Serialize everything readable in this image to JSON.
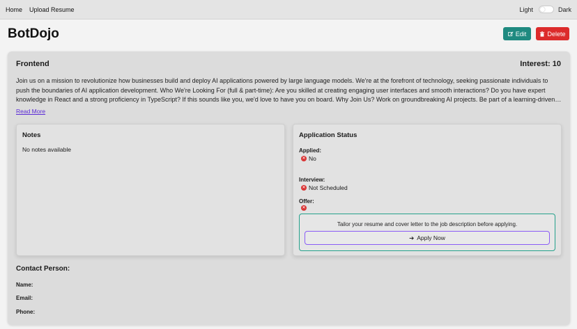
{
  "nav": {
    "home": "Home",
    "upload": "Upload Resume",
    "theme_light": "Light",
    "theme_dark": "Dark"
  },
  "header": {
    "title": "BotDojo",
    "edit_label": "Edit",
    "delete_label": "Delete"
  },
  "job": {
    "title": "Frontend",
    "interest": "Interest: 10",
    "description": "Join us on a mission to revolutionize how businesses build and deploy AI applications powered by large language models. We're at the forefront of technology, seeking passionate individuals to push the boundaries of AI application development. Who We're Looking For (full & part-time): Are you skilled at creating engaging user interfaces and smooth interactions? Do you have expert knowledge in React and a strong proficiency in TypeScript? If this sounds like you, we'd love to have you on board. Why Join Us? Work on groundbreaking AI projects. Be part of a learning-driven team.",
    "read_more": "Read More"
  },
  "notes": {
    "title": "Notes",
    "empty": "No notes available"
  },
  "status": {
    "title": "Application Status",
    "applied_label": "Applied:",
    "applied_value": "No",
    "interview_label": "Interview:",
    "interview_value": "Not Scheduled",
    "offer_label": "Offer:",
    "offer_value": "",
    "hint": "Tailor your resume and cover letter to the job description before applying.",
    "apply_label": "Apply Now"
  },
  "contact": {
    "title": "Contact Person:",
    "name_label": "Name:",
    "email_label": "Email:",
    "phone_label": "Phone:"
  },
  "colors": {
    "edit": "#1f8a80",
    "delete": "#dc2b2b",
    "status_negative": "#d93535",
    "apply_border": "#24a08a",
    "apply_button_border": "#8b5cf6",
    "link": "#5b2bd6"
  },
  "icons": {
    "edit": "edit-icon",
    "delete": "trash-icon",
    "status": "x-circle-icon",
    "apply": "arrow-right-icon"
  }
}
